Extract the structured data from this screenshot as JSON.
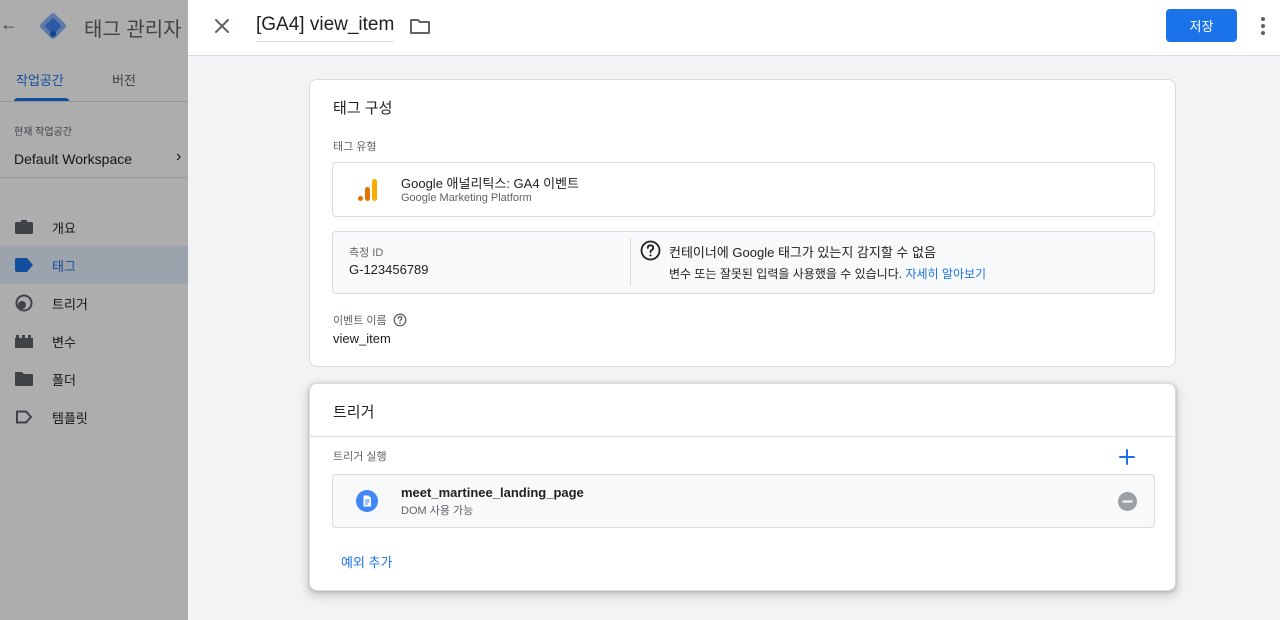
{
  "background_app": {
    "title": "태그 관리자",
    "tabs": [
      {
        "label": "작업공간",
        "active": true
      },
      {
        "label": "버전",
        "active": false
      }
    ],
    "workspace_label": "현재 작업공간",
    "workspace_name": "Default Workspace",
    "nav": [
      {
        "label": "개요",
        "icon": "briefcase-icon",
        "active": false
      },
      {
        "label": "태그",
        "icon": "tag-icon",
        "active": true
      },
      {
        "label": "트리거",
        "icon": "trigger-icon",
        "active": false
      },
      {
        "label": "변수",
        "icon": "variables-icon",
        "active": false
      },
      {
        "label": "폴더",
        "icon": "folder-icon",
        "active": false
      },
      {
        "label": "템플릿",
        "icon": "template-icon",
        "active": false
      }
    ]
  },
  "header": {
    "tag_name": "[GA4] view_item",
    "save_label": "저장"
  },
  "tag_config": {
    "title": "태그 구성",
    "type_label": "태그 유형",
    "type_name": "Google 애널리틱스: GA4 이벤트",
    "type_sub": "Google Marketing Platform",
    "measurement_label": "측정 ID",
    "measurement_id": "G-123456789",
    "warning_title": "컨테이너에 Google 태그가 있는지 감지할 수 없음",
    "warning_text": "변수 또는 잘못된 입력을 사용했을 수 있습니다.",
    "warning_link": "자세히 알아보기",
    "event_name_label": "이벤트 이름",
    "event_name": "view_item"
  },
  "triggering": {
    "title": "트리거",
    "firing_label": "트리거 실행",
    "trigger_name": "meet_martinee_landing_page",
    "trigger_type": "DOM 사용 가능",
    "add_exception": "예외 추가"
  },
  "colors": {
    "accent": "#1a73e8",
    "ga_orange": "#f9ab00",
    "ga_dark_orange": "#e37400"
  }
}
